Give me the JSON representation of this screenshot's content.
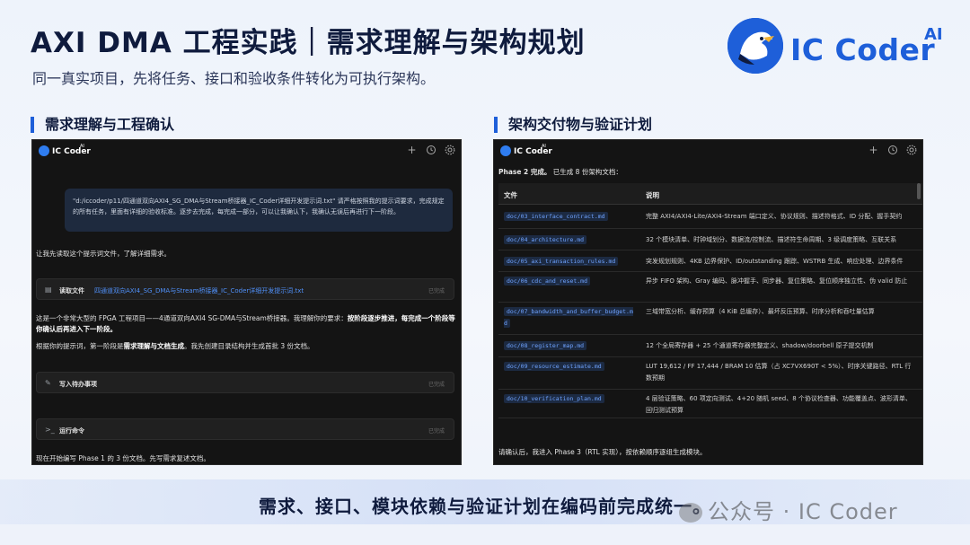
{
  "slide": {
    "title": "AXI DMA 工程实践｜需求理解与架构规划",
    "subtitle": "同一真实项目，先将任务、接口和验收条件转化为可执行架构。",
    "logo_text": "IC Coder",
    "logo_sup": "AI",
    "section_left": "需求理解与工程确认",
    "section_right": "架构交付物与验证计划",
    "bottom_text": "需求、接口、模块依赖与验证计划在编码前完成统一。",
    "watermark": "公众号 · IC Coder",
    "accent_color": "#1e5fd9"
  },
  "app": {
    "name": "IC Coder",
    "sup": "AI",
    "header_icons": [
      "plus-icon",
      "history-icon",
      "settings-icon"
    ]
  },
  "left_panel": {
    "prompt": "\"d:/iccoder/p11/四通道双向AXI4_SG_DMA与Stream桥接器_IC_Coder详细开发提示词.txt\" 请严格按照我的提示词要求，完成规定的所有任务，里面有详细的验收标准。逐步去完成，每完成一部分，可以让我确认下，我确认无误后再进行下一阶段。",
    "line1": "让我先读取这个提示词文件，了解详细需求。",
    "read_file_label": "读取文件",
    "read_file_name": "四通道双向AXI4_SG_DMA与Stream桥接器_IC_Coder详细开发提示词.txt",
    "read_file_status": "已完成",
    "para_a": "这是一个非常大型的 FPGA 工程项目——4通道双向AXI4 SG-DMA与Stream桥接器。我理解你的要求：",
    "para_b": "按阶段逐步推进，每完成一个阶段等你确认后再进入下一阶段。",
    "line3_a": "根据你的提示词，第一阶段是",
    "line3_b": "需求理解与文档生成",
    "line3_c": "。我先创建目录结构并生成首批 3 份文档。",
    "todo_label": "写入待办事项",
    "todo_status": "已完成",
    "cmd_label": "运行命令",
    "cmd_status": "已完成",
    "footer": "现在开始编写 Phase 1 的 3 份文档。先写需求复述文档。"
  },
  "right_panel": {
    "phase_a": "Phase 2 完成。",
    "phase_b": "已生成 8 份架构文档：",
    "col_file": "文件",
    "col_desc": "说明",
    "rows": [
      {
        "file": "doc/03_interface_contract.md",
        "desc": "完整 AXI4/AXI4-Lite/AXI4-Stream 端口定义、协议规则、描述符格式、ID 分配、握手契约"
      },
      {
        "file": "doc/04_architecture.md",
        "desc": "32 个模块清单、时钟域划分、数据流/控制流、描述符生命周期、3 级调度策略、互联关系"
      },
      {
        "file": "doc/05_axi_transaction_rules.md",
        "desc": "突发规划规则、4KB 边界保护、ID/outstanding 跟踪、WSTRB 生成、响应处理、边界条件"
      },
      {
        "file": "doc/06_cdc_and_reset.md",
        "desc": "异步 FIFO 架构、Gray 编码、脉冲握手、同步器、复位策略、复位顺序独立性、伪 valid 防止"
      },
      {
        "file": "doc/07_bandwidth_and_buffer_budget.md",
        "desc": "三域带宽分析、缓存预算（4 KiB 总缓存）、最坏反压预算、时序分析和吞吐量估算"
      },
      {
        "file": "doc/08_register_map.md",
        "desc": "12 个全局寄存器 + 25 个通道寄存器完整定义、shadow/doorbell 原子提交机制"
      },
      {
        "file": "doc/09_resource_estimate.md",
        "desc": "LUT 19,612 / FF 17,444 / BRAM 10 估算（占 XC7VX690T < 5%）、时序关键路径、RTL 行数预期"
      },
      {
        "file": "doc/10_verification_plan.md",
        "desc": "4 层验证策略、60 项定向测试、4+20 随机 seed、8 个协议检查器、功能覆盖点、波形清单、回归测试预算"
      }
    ],
    "footer": "请确认后，我进入 Phase 3（RTL 实现），按依赖顺序逐组生成模块。"
  }
}
